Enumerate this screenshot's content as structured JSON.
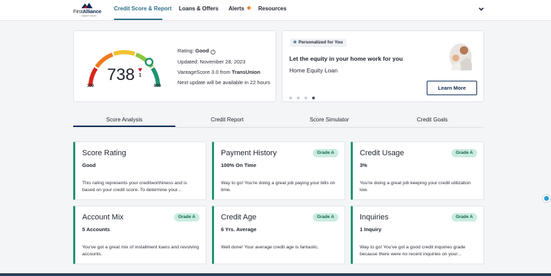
{
  "brand": {
    "name_prefix": "First",
    "name_bold": "Alliance",
    "tagline": "CREDIT UNION"
  },
  "nav": {
    "items": [
      {
        "label": "Credit Score & Report"
      },
      {
        "label": "Loans & Offers"
      },
      {
        "label": "Alerts"
      },
      {
        "label": "Resources"
      }
    ]
  },
  "score": {
    "value": "738",
    "delta": "1",
    "min": "300",
    "max": "850",
    "rating_label": "Rating:",
    "rating_value": "Good",
    "updated": "Updated: November 28, 2023",
    "model_prefix": "VantageScore 3.0 from ",
    "model_bureau": "TransUnion",
    "next_update": "Next update will be available in 22 hours",
    "gauge_fraction": 0.85
  },
  "promo": {
    "badge": "Personalized for You",
    "title": "Let the equity in your home work for you",
    "subtitle": "Home Equity Loan",
    "button": "Learn More",
    "slide_count": 4,
    "active_slide": 4
  },
  "tabs": [
    {
      "label": "Score Analysis"
    },
    {
      "label": "Credit Report"
    },
    {
      "label": "Score Simulator"
    },
    {
      "label": "Credit Goals"
    }
  ],
  "factors": [
    {
      "title": "Score Rating",
      "value": "Good",
      "grade": "",
      "desc": "This rating represents your creditworthiness and is based on your credit score. To determine your..."
    },
    {
      "title": "Payment History",
      "value": "100% On Time",
      "grade": "Grade A",
      "desc": "Way to go! You're doing a great job paying your bills on time."
    },
    {
      "title": "Credit Usage",
      "value": "3%",
      "grade": "Grade A",
      "desc": "You're doing a great job keeping your credit utilization low."
    },
    {
      "title": "Account Mix",
      "value": "5 Accounts",
      "grade": "Grade A",
      "desc": "You've got a great mix of installment loans and revolving accounts."
    },
    {
      "title": "Credit Age",
      "value": "6 Yrs. Average",
      "grade": "Grade A",
      "desc": "Well done! Your average credit age is fantastic."
    },
    {
      "title": "Inquiries",
      "value": "1 Inquiry",
      "grade": "Grade A",
      "desc": "Way to go! You've got a good credit inquiries grade because there were no recent inquiries on your..."
    }
  ],
  "colors": {
    "accent": "#2a6f8a",
    "navy": "#0d2b55",
    "grade_bg": "#c9ecdf",
    "grade_text": "#14664e",
    "card_border": "#1e9470",
    "alert_dot": "#e8892b",
    "delta_red": "#c8102e"
  },
  "icons": {
    "logo": "mountain-logo-icon",
    "expand": "chevron-down-icon",
    "info": "info-icon",
    "star": "star-icon",
    "caret": "caret-down-icon",
    "chat": "chat-widget-icon"
  }
}
